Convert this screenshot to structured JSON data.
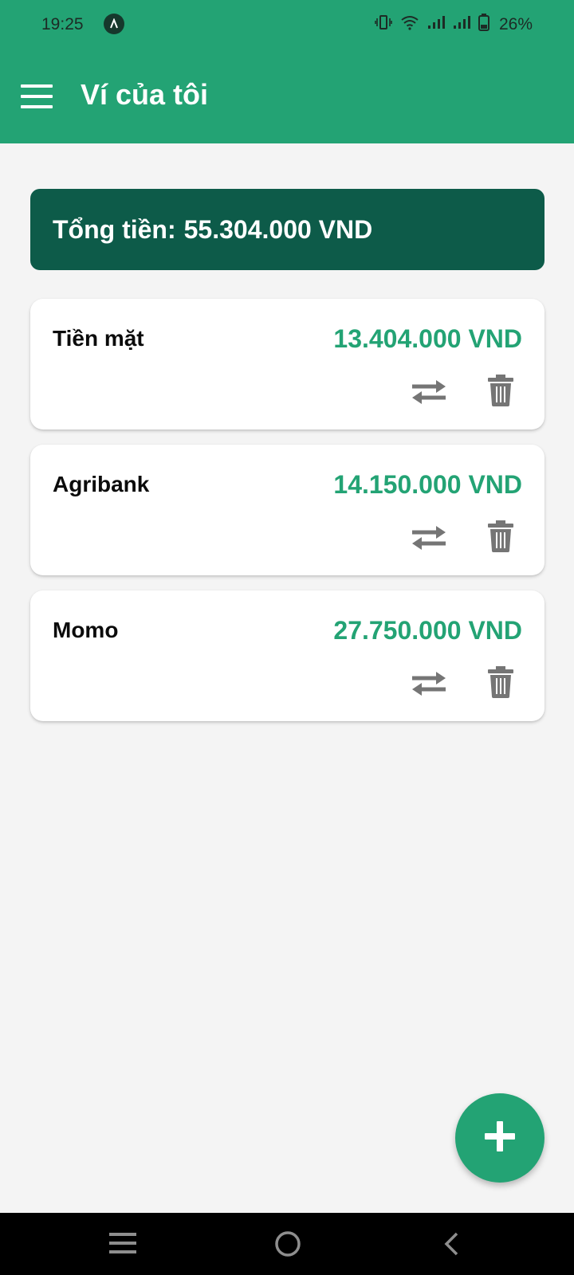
{
  "status_bar": {
    "time": "19:25",
    "battery": "26%",
    "icons": [
      "vibrate-icon",
      "wifi-icon",
      "signal-icon",
      "signal-icon",
      "battery-icon"
    ]
  },
  "toolbar": {
    "title": "Ví của tôi",
    "menu_icon": "hamburger-menu-icon"
  },
  "total": {
    "label": "Tổng tiền:",
    "value": "55.304.000 VND"
  },
  "wallets": [
    {
      "name": "Tiền mặt",
      "amount": "13.404.000 VND"
    },
    {
      "name": "Agribank",
      "amount": "14.150.000 VND"
    },
    {
      "name": "Momo",
      "amount": "27.750.000 VND"
    }
  ],
  "actions": {
    "transfer_icon": "transfer-arrows-icon",
    "delete_icon": "trash-icon"
  },
  "fab": {
    "icon": "plus-icon"
  },
  "colors": {
    "primary": "#23a374",
    "dark": "#0d5b49",
    "background": "#f4f4f4",
    "icon_gray": "#757575"
  }
}
